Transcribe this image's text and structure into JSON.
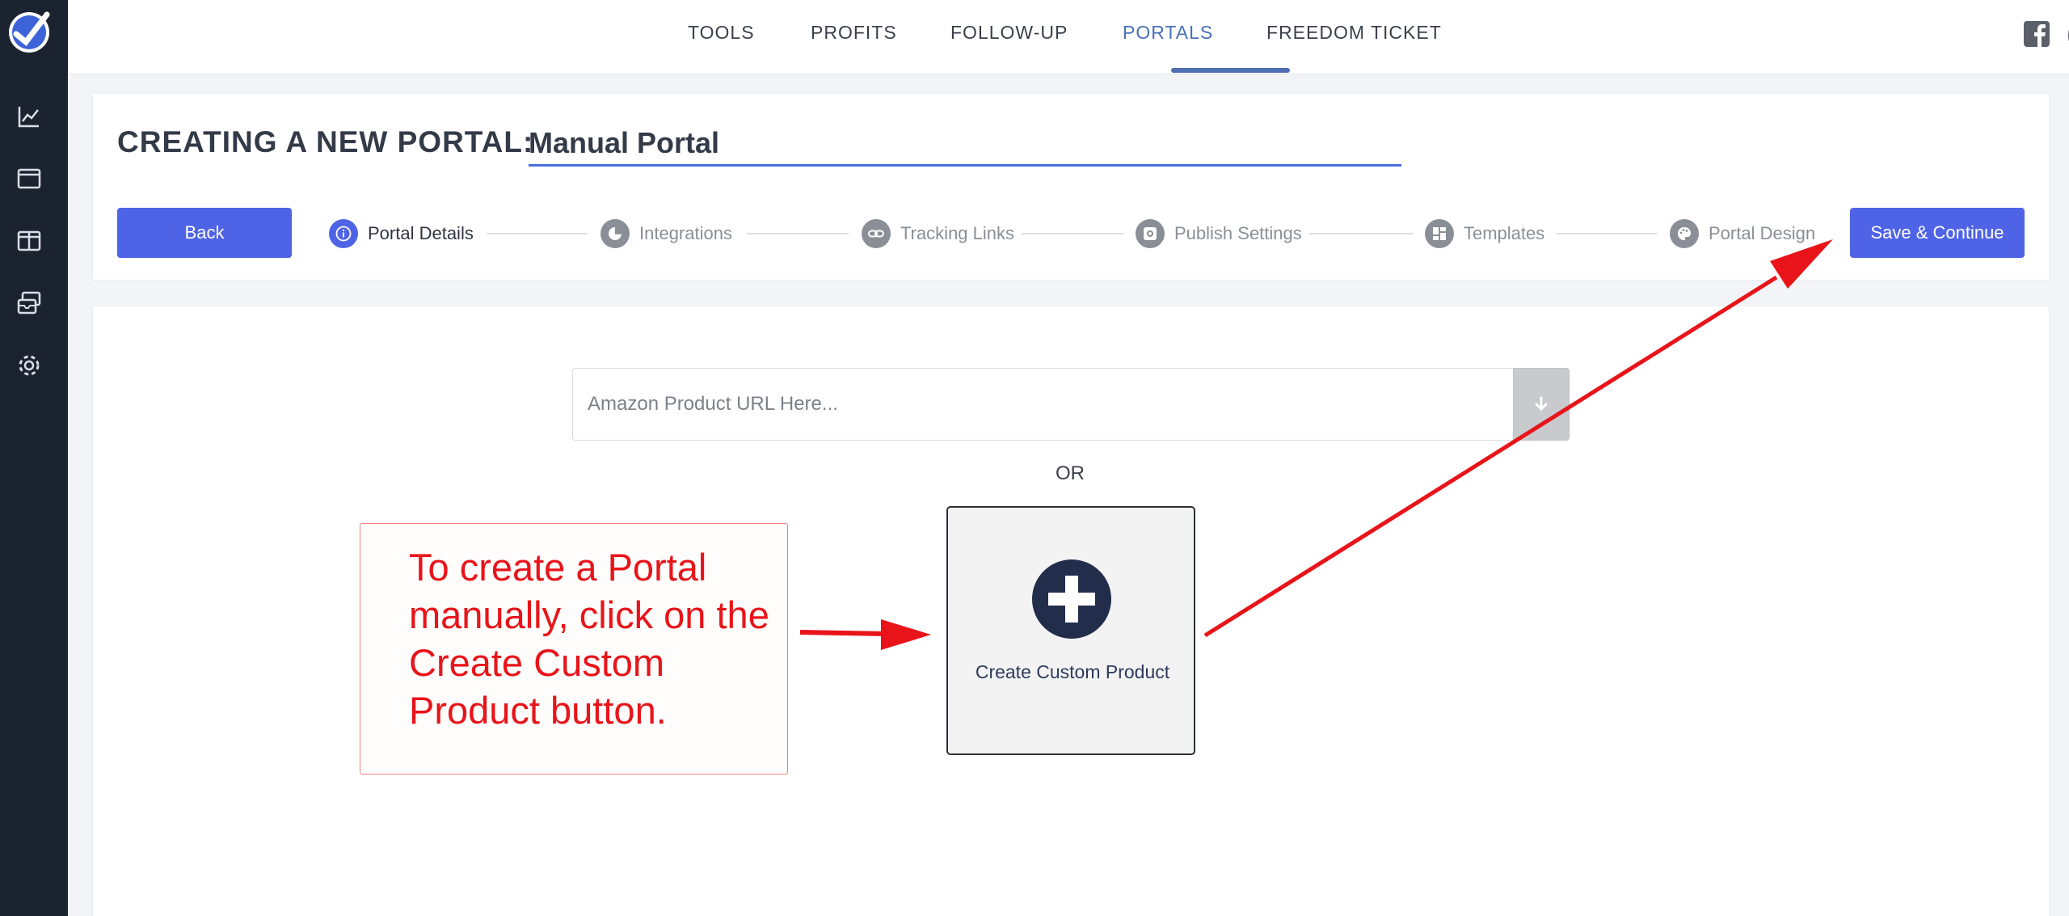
{
  "nav": {
    "items": [
      "TOOLS",
      "PROFITS",
      "FOLLOW-UP",
      "PORTALS",
      "FREEDOM TICKET"
    ],
    "active": "PORTALS"
  },
  "header": {
    "title": "CREATING A NEW PORTAL:",
    "portal_name": "Manual Portal"
  },
  "buttons": {
    "back": "Back",
    "save": "Save & Continue"
  },
  "steps": [
    {
      "label": "Portal Details",
      "icon": "info-icon",
      "active": true
    },
    {
      "label": "Integrations",
      "icon": "pie-chart-icon",
      "active": false
    },
    {
      "label": "Tracking Links",
      "icon": "link-icon",
      "active": false
    },
    {
      "label": "Publish Settings",
      "icon": "settings-box-icon",
      "active": false
    },
    {
      "label": "Templates",
      "icon": "grid-layout-icon",
      "active": false
    },
    {
      "label": "Portal Design",
      "icon": "palette-icon",
      "active": false
    }
  ],
  "main": {
    "url_placeholder": "Amazon Product URL Here...",
    "or_text": "OR",
    "custom_product_label": "Create Custom Product"
  },
  "annotation": {
    "text": "To create a Portal manually, click on the Create Custom Product button.",
    "color": "#e8141a"
  },
  "sidebar_icons": [
    "logo-icon",
    "chart-icon",
    "browser-window-icon",
    "columns-icon",
    "inbox-stack-icon",
    "gear-icon"
  ],
  "colors": {
    "sidebar": "#1c2330",
    "primary": "#4f63e6",
    "nav_active": "#4b70b8"
  }
}
